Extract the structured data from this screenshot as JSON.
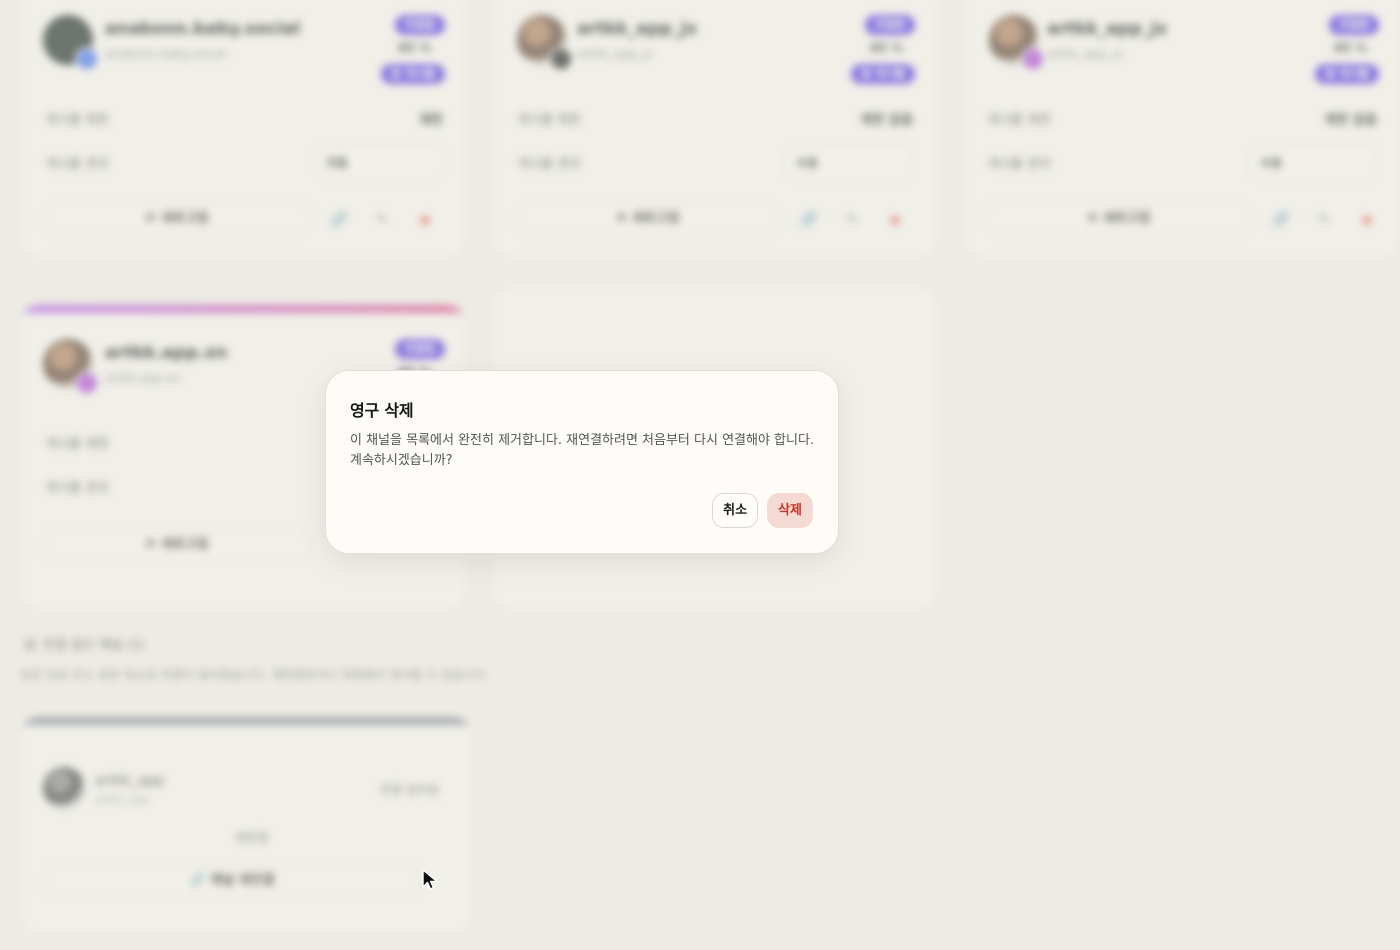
{
  "background": {
    "cards": [
      {
        "name": "anakonn.baby.social",
        "handle": "anakonn.baby.social",
        "badge": "연결됨",
        "rate": "85 %",
        "tag": "알 게시물",
        "row1_label": "게시물 제한",
        "row1_value": "제한",
        "row2_label": "게시물 관리",
        "row2_value": "자동",
        "action_label": "새로고침",
        "platform_color": "#4f7cf0"
      },
      {
        "name": "artkk_app_jx",
        "handle": "artkk_app_jx",
        "badge": "연결됨",
        "rate": "85 %",
        "tag": "알 게시물",
        "row1_label": "게시물 제한",
        "row1_value": "제한 없음",
        "row2_label": "게시물 관리",
        "row2_value": "수동",
        "action_label": "새로고침",
        "platform_color": "#333333"
      },
      {
        "name": "artkk_app_jx",
        "handle": "artkk_app_jx",
        "badge": "연결됨",
        "rate": "85 %",
        "tag": "알 게시물",
        "row1_label": "게시물 제한",
        "row1_value": "제한 없음",
        "row2_label": "게시물 관리",
        "row2_value": "수동",
        "action_label": "새로고침",
        "platform_color": "#b055d8"
      },
      {
        "name": "artkk.app.xn",
        "handle": "artkk.app.xn",
        "badge": "연결됨",
        "rate": "85 %",
        "row1_label": "게시물 제한",
        "row2_label": "게시물 관리",
        "action_label": "새로고침",
        "platform_color": "#b055d8"
      }
    ],
    "section": {
      "title": "연결 끊긴 채널 (1)",
      "description": "토큰 만료 또는 권한 취소로 연결이 끊어졌습니다. 재연결하거나 목록에서 제거할 수 있습니다."
    },
    "disconnected_card": {
      "name": "artkk_app",
      "handle": "artkk_app",
      "status": "연결 끊어짐",
      "center_text": "재연결",
      "reconnect_label": "채널 재연결"
    },
    "icons": {
      "refresh": "refresh-icon",
      "link": "link-icon",
      "edit": "edit-icon",
      "trash": "trash-icon"
    }
  },
  "dialog": {
    "title": "영구 삭제",
    "body": "이 채널을 목록에서 완전히 제거합니다. 재연결하려면 처음부터 다시 연결해야 합니다. 계속하시겠습니까?",
    "cancel_label": "취소",
    "delete_label": "삭제"
  },
  "colors": {
    "badge": "#5b3fe0",
    "delete_bg": "#f5d9d3",
    "delete_text": "#c7372a",
    "accent_gradient_start": "#b56af0",
    "accent_gradient_end": "#e0568c",
    "disconnected_accent": "#8a929e"
  }
}
